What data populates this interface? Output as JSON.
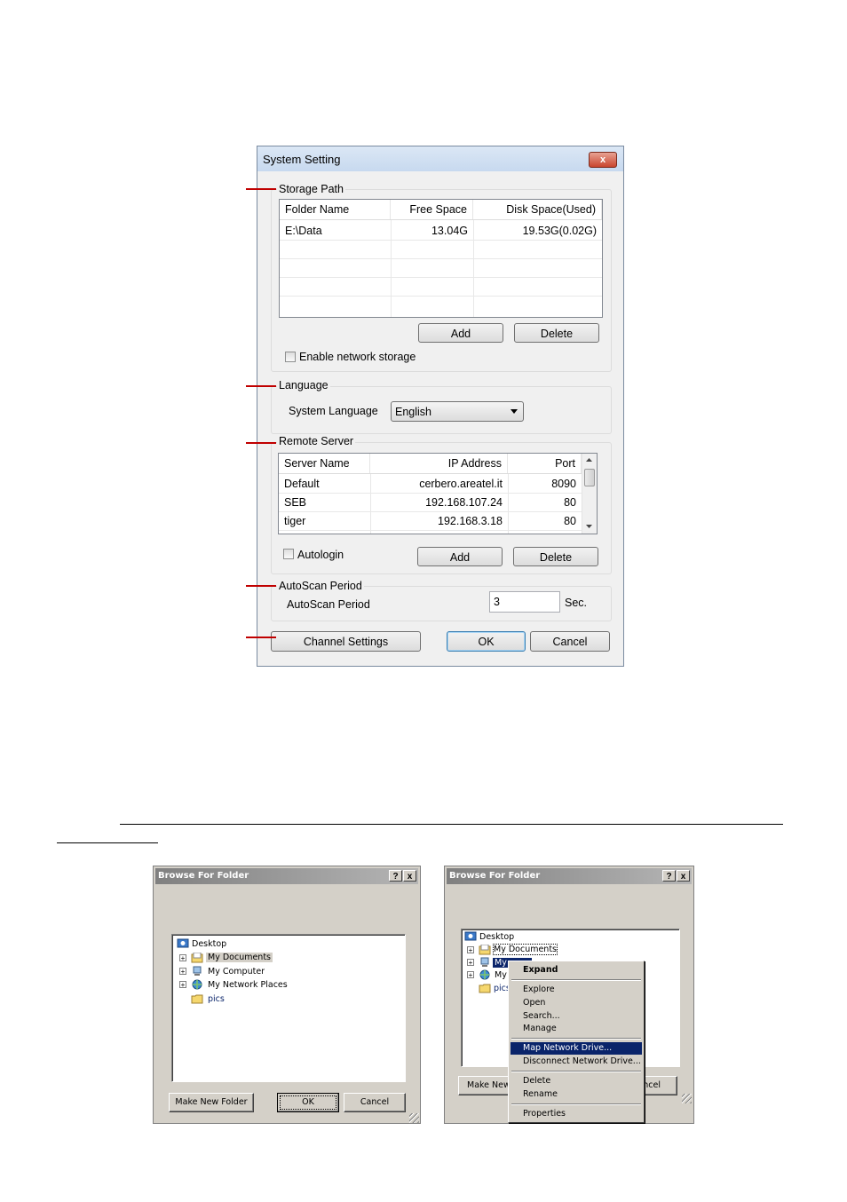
{
  "system_setting": {
    "title": "System Setting",
    "close_glyph": "x",
    "storage": {
      "group_label": "Storage Path",
      "columns": [
        "Folder Name",
        "Free Space",
        "Disk Space(Used)"
      ],
      "rows": [
        [
          "E:\\Data",
          "13.04G",
          "19.53G(0.02G)"
        ]
      ],
      "add_label": "Add",
      "delete_label": "Delete",
      "network_label": "Enable network storage"
    },
    "language": {
      "group_label": "Language",
      "field_label": "System Language",
      "selected": "English"
    },
    "remote": {
      "group_label": "Remote Server",
      "columns": [
        "Server Name",
        "IP Address",
        "Port"
      ],
      "rows": [
        [
          "Default",
          "cerbero.areatel.it",
          "8090"
        ],
        [
          "SEB",
          "192.168.107.24",
          "80"
        ],
        [
          "tiger",
          "192.168.3.18",
          "80"
        ]
      ],
      "autologin_label": "Autologin",
      "add_label": "Add",
      "delete_label": "Delete"
    },
    "autoscan": {
      "group_label": "AutoScan Period",
      "field_label": "AutoScan Period",
      "value": "3",
      "unit": "Sec."
    },
    "channel_settings_label": "Channel Settings",
    "ok_label": "OK",
    "cancel_label": "Cancel"
  },
  "browse_left": {
    "title": "Browse For Folder",
    "help_glyph": "?",
    "close_glyph": "x",
    "tree": [
      "Desktop",
      "My Documents",
      "My Computer",
      "My Network Places",
      "pics"
    ],
    "make_new_folder_label": "Make New Folder",
    "ok_label": "OK",
    "cancel_label": "Cancel"
  },
  "browse_right": {
    "title": "Browse For Folder",
    "help_glyph": "?",
    "close_glyph": "x",
    "tree": [
      "Desktop",
      "My Documents",
      "My",
      "My",
      "pics"
    ],
    "make_new_folder_label": "Make New",
    "cancel_label": "ancel",
    "context_menu": [
      "Expand",
      "Explore",
      "Open",
      "Search...",
      "Manage",
      "Map Network Drive...",
      "Disconnect Network Drive...",
      "Delete",
      "Rename",
      "Properties"
    ]
  },
  "colors": {
    "marker": "#c00000",
    "classic_face": "#d4d0c8",
    "menu_highlight": "#0a246a",
    "win7_face": "#f0f0f0"
  }
}
